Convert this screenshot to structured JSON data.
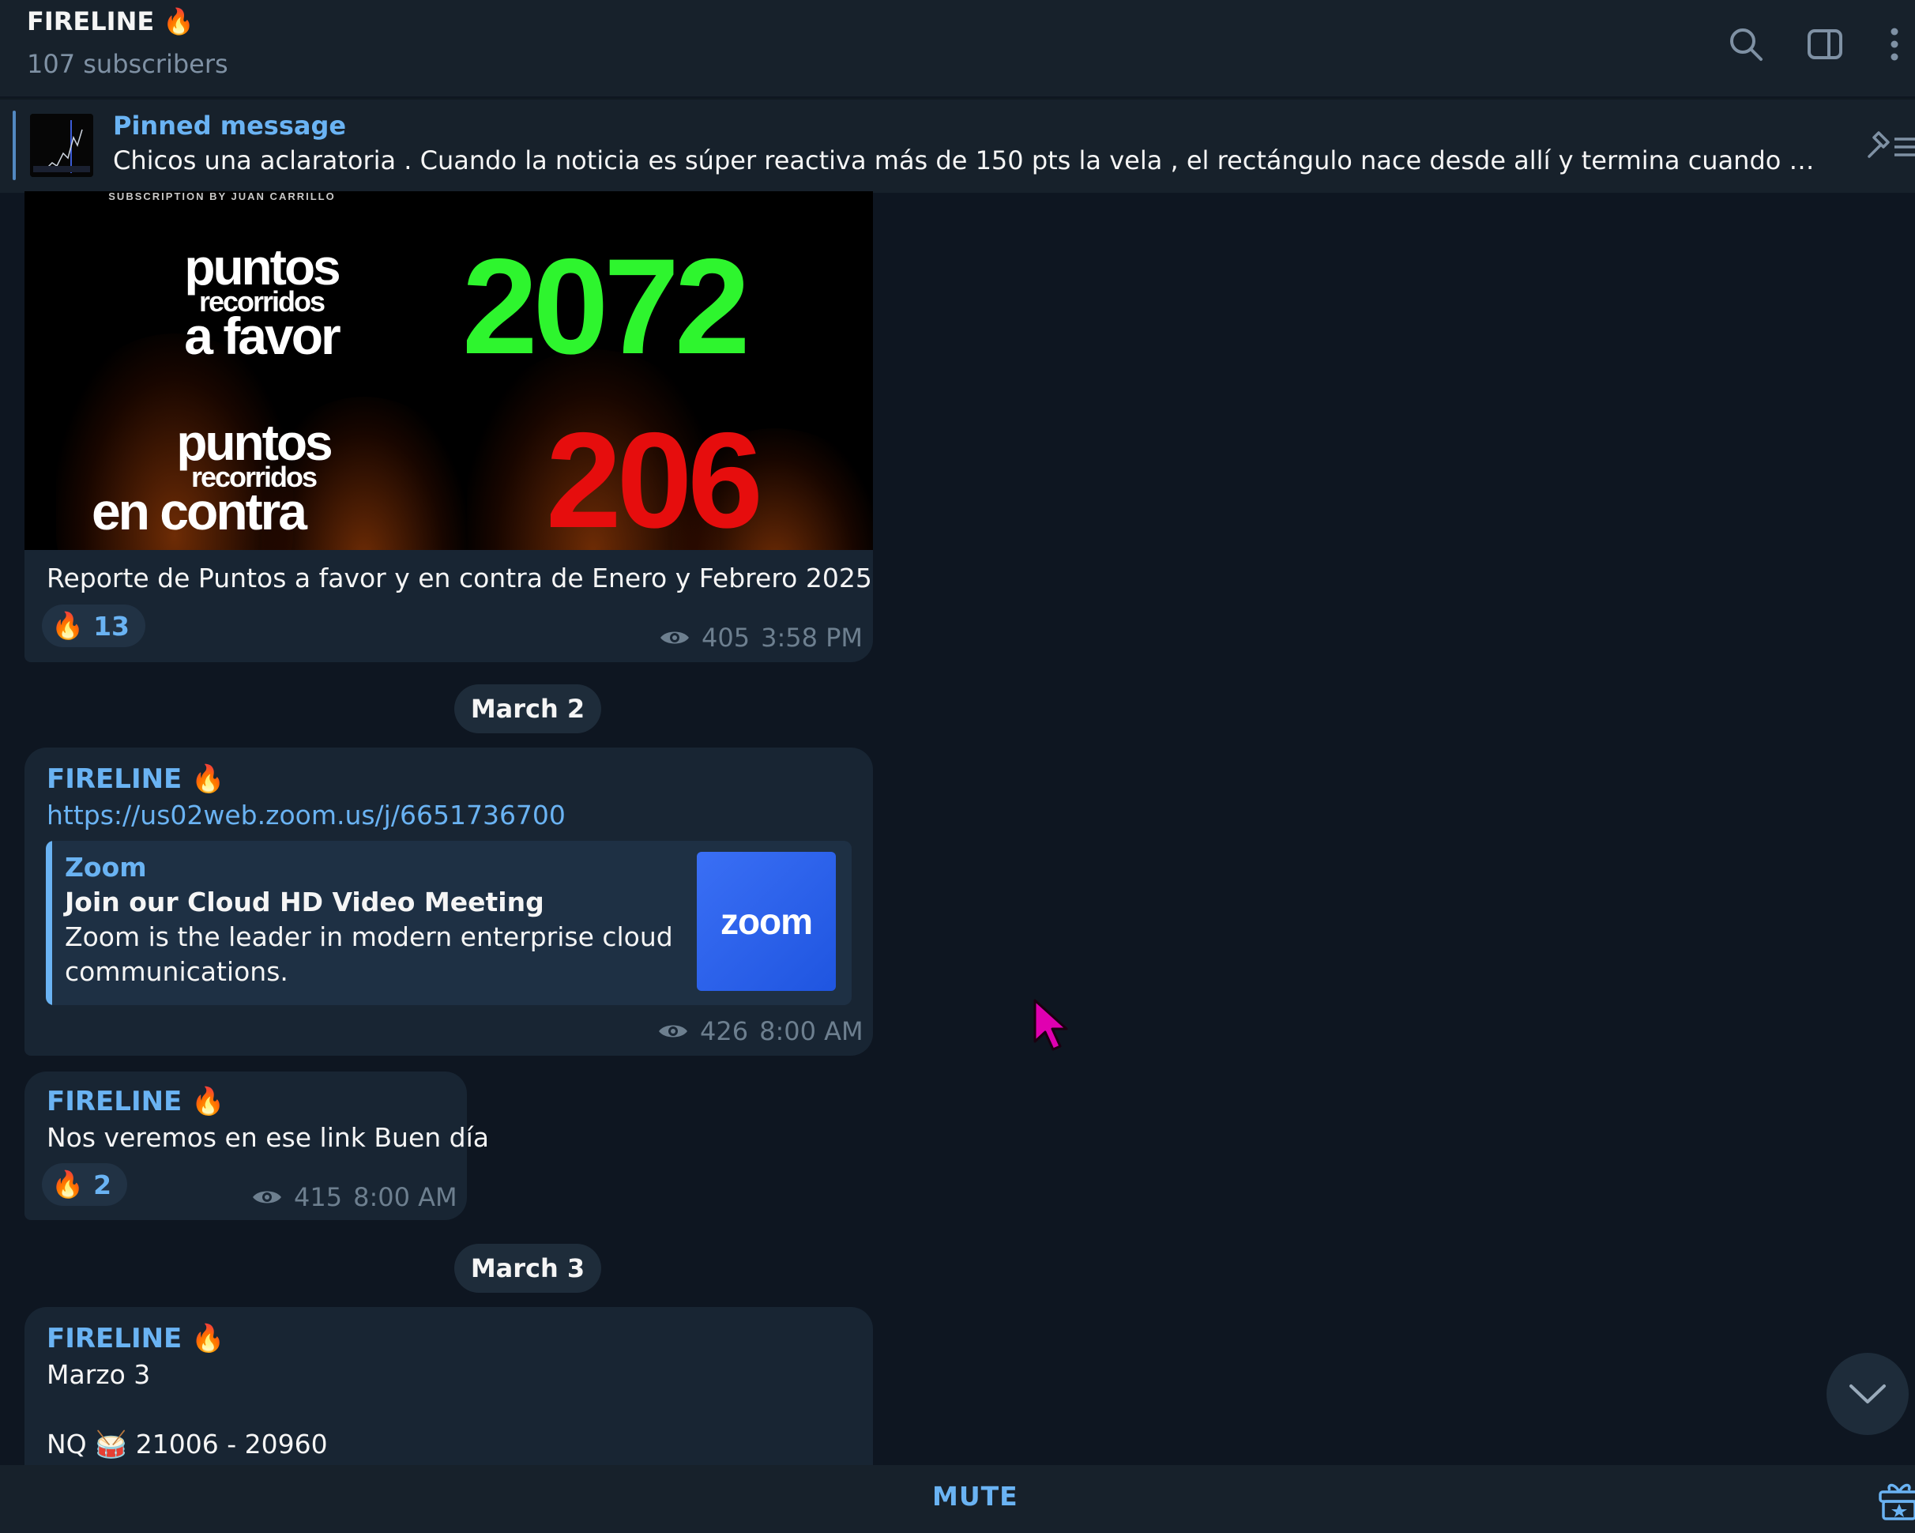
{
  "header": {
    "title": "FIRELINE 🔥",
    "subtitle": "107 subscribers",
    "icons": [
      "search-icon",
      "sidebar-toggle-icon",
      "more-vertical-icon"
    ]
  },
  "pinned": {
    "title": "Pinned message",
    "text": "Chicos una aclaratoria .  Cuando la noticia es súper reactiva más de 150 pts la vela , el rectángulo nace desde allí y termina cuando complete las..."
  },
  "poster": {
    "header_text": "SUBSCRIPTION BY JUAN CARRILLO",
    "favor_label_1": "puntos",
    "favor_label_2": "recorridos",
    "favor_label_3": "a favor",
    "favor_value": "2072",
    "contra_label_1": "puntos",
    "contra_label_2": "recorridos",
    "contra_label_3": "en contra",
    "contra_value": "206",
    "favor_color": "#2ef52e",
    "contra_color": "#e60d0d"
  },
  "messages": [
    {
      "caption": "Reporte de Puntos a favor y en contra de Enero y Febrero 2025",
      "reaction_emoji": "🔥",
      "reaction_count": "13",
      "views": "405",
      "time": "3:58 PM"
    },
    {
      "sender": "FIRELINE 🔥",
      "link": "https://us02web.zoom.us/j/6651736700",
      "preview": {
        "site": "Zoom",
        "title": "Join our Cloud HD Video Meeting",
        "description_1": "Zoom is the leader in modern enterprise cloud",
        "description_2": "communications.",
        "logo_text": "zoom"
      },
      "views": "426",
      "time": "8:00 AM"
    },
    {
      "sender": "FIRELINE 🔥",
      "text": "Nos veremos en ese link Buen día",
      "reaction_emoji": "🔥",
      "reaction_count": "2",
      "views": "415",
      "time": "8:00 AM"
    },
    {
      "sender": "FIRELINE 🔥",
      "line_1": "Marzo 3",
      "line_2": "NQ 🥁 21006 - 20960"
    }
  ],
  "dates": [
    "March 2",
    "March 3"
  ],
  "bottom": {
    "mute_label": "MUTE"
  },
  "colors": {
    "background": "#0e1621",
    "panel": "#17212b",
    "bubble": "#182533",
    "accent": "#6ab3f3",
    "cursor": "#e000b0"
  }
}
